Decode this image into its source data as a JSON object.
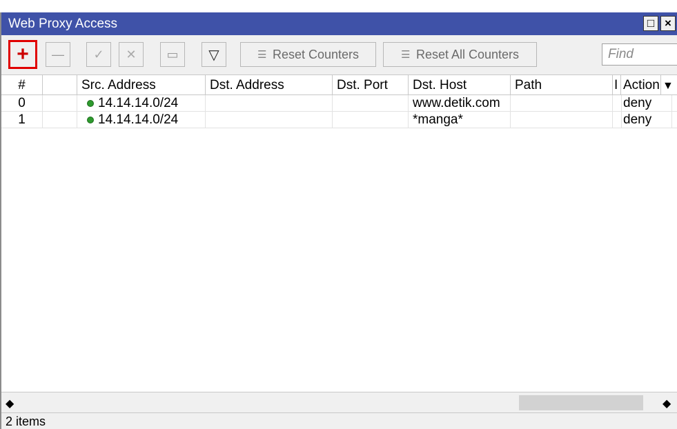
{
  "window": {
    "title": "Web Proxy Access",
    "restore_glyph": "□",
    "close_glyph": "×"
  },
  "toolbar": {
    "add_glyph": "+",
    "remove_glyph": "—",
    "enable_glyph": "✓",
    "disable_glyph": "✕",
    "comment_glyph": "▭",
    "filter_glyph": "▽",
    "reset_counters_label": "Reset Counters",
    "reset_all_counters_label": "Reset All Counters",
    "find_placeholder": "Find"
  },
  "table": {
    "columns": [
      "#",
      "",
      "Src. Address",
      "Dst. Address",
      "Dst. Port",
      "Dst. Host",
      "Path",
      "I",
      "Action"
    ],
    "rows": [
      {
        "num": "0",
        "src": "14.14.14.0/24",
        "dst_addr": "",
        "dst_port": "",
        "dst_host": "www.detik.com",
        "path": "",
        "action": "deny"
      },
      {
        "num": "1",
        "src": "14.14.14.0/24",
        "dst_addr": "",
        "dst_port": "",
        "dst_host": "*manga*",
        "path": "",
        "action": "deny"
      }
    ],
    "status_dot_color": "#2e9a2e"
  },
  "status": {
    "items_count": "2 items"
  },
  "colors": {
    "titlebar": "#3f52a8",
    "add_highlight": "#e00000",
    "add_icon": "#cc0000"
  }
}
